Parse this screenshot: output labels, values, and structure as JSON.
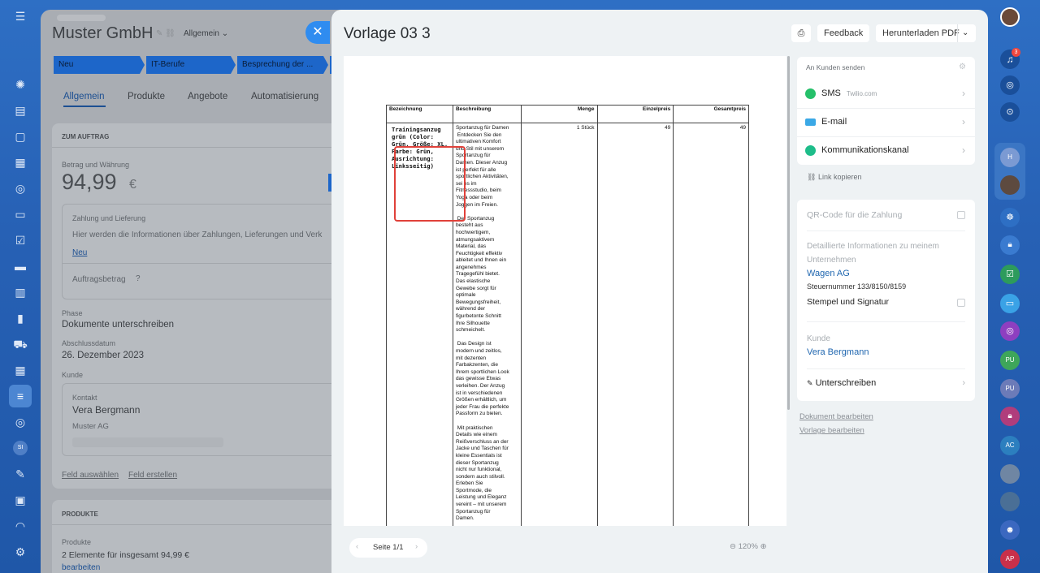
{
  "underlying": {
    "company": "Muster GmbH",
    "category": "Allgemein",
    "stages": [
      "Neu",
      "IT-Berufe",
      "Besprechung der ..."
    ],
    "tabs": [
      "Allgemein",
      "Produkte",
      "Angebote",
      "Automatisierung"
    ],
    "section_title": "ZUM AUFTRAG",
    "amount_label": "Betrag und Währung",
    "amount": "94,99",
    "currency": "€",
    "payment_label": "Zahlung und Lieferung",
    "payment_text": "Hier werden die Informationen über Zahlungen, Lieferungen und Verk",
    "payment_link": "Neu",
    "order_amount_label": "Auftragsbetrag",
    "phase_label": "Phase",
    "phase_value": "Dokumente unterschreiben",
    "close_date_label": "Abschlussdatum",
    "close_date": "26. Dezember 2023",
    "customer_label": "Kunde",
    "contact_label": "Kontakt",
    "contact_name": "Vera Bergmann",
    "contact_company": "Muster AG",
    "select_field": "Feld auswählen",
    "create_field": "Feld erstellen",
    "products_title": "PRODUKTE",
    "products_label": "Produkte",
    "products_summary": "2 Elemente für insgesamt 94,99 €",
    "products_edit": "bearbeiten"
  },
  "panel": {
    "title": "Vorlage 03 3",
    "feedback": "Feedback",
    "download": "Herunterladen PDF",
    "page_indicator": "Seite 1/1",
    "zoom": "120%"
  },
  "document": {
    "headers": [
      "Bezeichnung",
      "Beschreibung",
      "Menge",
      "Einzelpreis",
      "Gesamtpreis"
    ],
    "item_name": "Trainingsanzug grün (Color: Grün, Größe: XL, Farbe: Grün, Ausrichtung: Linksseitig)",
    "description_lines": [
      "Sportanzug für Damen",
      " Entdecken Sie den",
      "ultimativen Komfort",
      "und Stil mit unserem",
      "Sportanzug für",
      "Damen. Dieser Anzug",
      "ist perfekt für alle",
      "sportlichen Aktivitäten,",
      "sei es im",
      "Fitnessstudio, beim",
      "Yoga oder beim",
      "Joggen im Freien.",
      "",
      " Der Sportanzug",
      "besteht aus",
      "hochwertigem,",
      "atmungsaktivem",
      "Material, das",
      "Feuchtigkeit effektiv",
      "ableitet und Ihnen ein",
      "angenehmes",
      "Tragegefühl bietet.",
      "Das elastische",
      "Gewebe sorgt für",
      "optimale",
      "Bewegungsfreiheit,",
      "während der",
      "figurbetonte Schnitt",
      "Ihre Silhouette",
      "schmeichelt.",
      "",
      " Das Design ist",
      "modern und zeitlos,",
      "mit dezenten",
      "Farbakzenten, die",
      "Ihrem sportlichen Look",
      "das gewisse Etwas",
      "verleihen. Der Anzug",
      "ist in verschiedenen",
      "Größen erhältlich, um",
      "jeder Frau die perfekte",
      "Passform zu bieten.",
      "",
      " Mit praktischen",
      "Details wie einem",
      "Reißverschluss an der",
      "Jacke und Taschen für",
      "kleine Essentials ist",
      "dieser Sportanzug",
      "nicht nur funktional,",
      "sondern auch stilvoll.",
      "Erleben Sie",
      "Sportmode, die",
      "Leistung und Eleganz",
      "vereint – mit unserem",
      "Sportanzug für",
      "Damen."
    ],
    "quantity": "1 Stück",
    "unit_price": "49",
    "total_price": "49"
  },
  "send": {
    "header": "An Kunden senden",
    "sms": "SMS",
    "sms_provider": "Twilio.com",
    "email": "E-mail",
    "channel": "Kommunikationskanal",
    "copy_link": "Link kopieren"
  },
  "settings": {
    "qr_code": "QR-Code für die Zahlung",
    "company_info_line1": "Detaillierte Informationen zu meinem",
    "company_info_line2": "Unternehmen",
    "company_name": "Wagen AG",
    "tax_number": "Steuernummer 133/8150/8159",
    "stamp": "Stempel und Signatur",
    "customer_label": "Kunde",
    "customer_name": "Vera Bergmann",
    "sign": "Unterschreiben"
  },
  "links": {
    "edit_document": "Dokument bearbeiten",
    "edit_template": "Vorlage bearbeiten"
  },
  "rightbar": {
    "notification_count": "3",
    "avatars": [
      "H",
      "PU",
      "PU",
      "AC",
      "AP"
    ]
  },
  "leftbar": {
    "si_badge": "SI"
  },
  "colors": {
    "accent": "#2f8cf0",
    "link": "#2067b0",
    "highlight": "#e0413a",
    "sms_green": "#25c06a",
    "email_blue": "#3aa8e6",
    "channel_teal": "#1ebd8a"
  }
}
